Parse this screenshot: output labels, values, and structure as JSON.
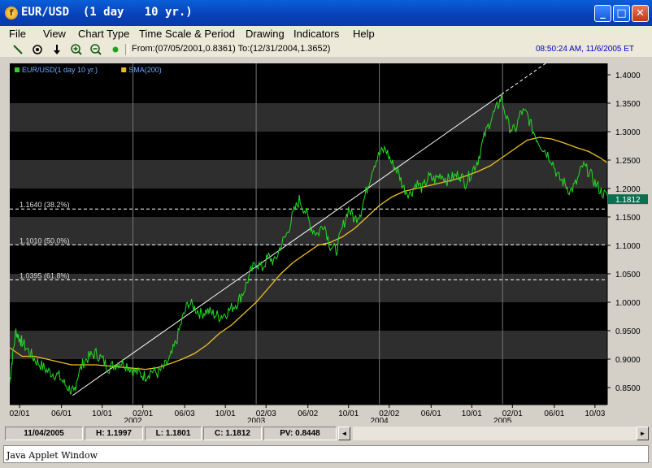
{
  "window": {
    "title": "EUR/USD  (1 day   10 yr.)",
    "app_icon": "f",
    "buttons": {
      "minimize": "_",
      "maximize": "□",
      "close": "✕"
    }
  },
  "menu": [
    "File",
    "View",
    "Chart Type",
    "Time Scale & Period",
    "Drawing",
    "Indicators",
    "Help"
  ],
  "toolbar": {
    "icons": [
      "line-tool-icon",
      "target-icon",
      "down-arrow-icon",
      "zoom-in-icon",
      "zoom-out-icon",
      "green-dot-icon"
    ],
    "range": "From:(07/05/2001,0.8361) To:(12/31/2004,1.3652)",
    "datetime": "08:50:24 AM, 11/6/2005 ET"
  },
  "legend": [
    {
      "label": "EUR/USD(1 day  10 yr.)",
      "color": "#33cc33"
    },
    {
      "label": "SMA(200)",
      "color": "#e8b820"
    }
  ],
  "colors": {
    "price": "#22dd22",
    "sma": "#f0c020",
    "background": "#000000",
    "band": "#2e2e2e",
    "last_price_bg": "#0a7050"
  },
  "fib_levels": [
    {
      "label": "1.1640 (38.2%)",
      "value": 1.164
    },
    {
      "label": "1.1010 (50.0%)",
      "value": 1.101
    },
    {
      "label": "1.0395 (61.8%)",
      "value": 1.0395
    }
  ],
  "trendline": {
    "start": [
      2001.51,
      0.8361
    ],
    "end": [
      2004.99,
      1.3652
    ],
    "extend_to": 2005.4
  },
  "chart_data": {
    "type": "line",
    "ylim": [
      0.82,
      1.42
    ],
    "xlim": [
      2001.0,
      2005.85
    ],
    "y_ticks": [
      0.85,
      0.9,
      0.95,
      1.0,
      1.05,
      1.1,
      1.15,
      1.2,
      1.25,
      1.3,
      1.35,
      1.4
    ],
    "y_tick_labels": [
      "0.8500",
      "0.9000",
      "0.9500",
      "1.0000",
      "1.0500",
      "1.1000",
      "1.1500",
      "1.2000",
      "1.2500",
      "1.3000",
      "1.3500",
      "1.4000"
    ],
    "x_ticks": [
      {
        "label": "02/01",
        "x": 2001.08
      },
      {
        "label": "06/01",
        "x": 2001.42
      },
      {
        "label": "10/01",
        "x": 2001.75
      },
      {
        "label": "02/01",
        "x": 2002.08
      },
      {
        "label": "06/03",
        "x": 2002.42
      },
      {
        "label": "10/01",
        "x": 2002.75
      },
      {
        "label": "02/03",
        "x": 2003.08
      },
      {
        "label": "06/02",
        "x": 2003.42
      },
      {
        "label": "10/01",
        "x": 2003.75
      },
      {
        "label": "02/02",
        "x": 2004.08
      },
      {
        "label": "06/01",
        "x": 2004.42
      },
      {
        "label": "10/01",
        "x": 2004.75
      },
      {
        "label": "02/01",
        "x": 2005.08
      },
      {
        "label": "06/01",
        "x": 2005.42
      },
      {
        "label": "10/03",
        "x": 2005.75
      }
    ],
    "year_ticks": [
      {
        "label": "2002",
        "x": 2002.0
      },
      {
        "label": "2003",
        "x": 2003.0
      },
      {
        "label": "2004",
        "x": 2004.0
      },
      {
        "label": "2005",
        "x": 2005.0
      }
    ],
    "last_price": "1.1812",
    "series": [
      {
        "name": "EUR/USD(1 day  10 yr.)",
        "x": [
          2001.0,
          2001.02,
          2001.05,
          2001.08,
          2001.1,
          2001.15,
          2001.2,
          2001.25,
          2001.3,
          2001.35,
          2001.4,
          2001.45,
          2001.5,
          2001.52,
          2001.55,
          2001.6,
          2001.65,
          2001.7,
          2001.75,
          2001.8,
          2001.85,
          2001.9,
          2001.95,
          2002.0,
          2002.05,
          2002.1,
          2002.15,
          2002.2,
          2002.25,
          2002.3,
          2002.35,
          2002.4,
          2002.45,
          2002.5,
          2002.55,
          2002.6,
          2002.65,
          2002.7,
          2002.75,
          2002.8,
          2002.85,
          2002.9,
          2002.95,
          2003.0,
          2003.05,
          2003.1,
          2003.15,
          2003.2,
          2003.25,
          2003.3,
          2003.35,
          2003.4,
          2003.45,
          2003.5,
          2003.55,
          2003.6,
          2003.65,
          2003.7,
          2003.75,
          2003.8,
          2003.85,
          2003.9,
          2003.95,
          2004.0,
          2004.05,
          2004.1,
          2004.15,
          2004.2,
          2004.25,
          2004.3,
          2004.35,
          2004.4,
          2004.45,
          2004.5,
          2004.55,
          2004.6,
          2004.65,
          2004.7,
          2004.75,
          2004.8,
          2004.85,
          2004.9,
          2004.95,
          2004.99,
          2005.05,
          2005.1,
          2005.15,
          2005.2,
          2005.25,
          2005.3,
          2005.35,
          2005.4,
          2005.45,
          2005.5,
          2005.55,
          2005.6,
          2005.65,
          2005.7,
          2005.75,
          2005.8,
          2005.85
        ],
        "values": [
          0.86,
          0.9,
          0.95,
          0.935,
          0.93,
          0.915,
          0.9,
          0.89,
          0.88,
          0.875,
          0.87,
          0.855,
          0.845,
          0.84,
          0.87,
          0.895,
          0.905,
          0.91,
          0.9,
          0.885,
          0.89,
          0.895,
          0.89,
          0.88,
          0.875,
          0.87,
          0.88,
          0.875,
          0.885,
          0.9,
          0.93,
          0.97,
          1.0,
          0.99,
          0.98,
          0.985,
          0.98,
          0.975,
          0.98,
          0.99,
          1.0,
          1.02,
          1.05,
          1.07,
          1.06,
          1.08,
          1.07,
          1.1,
          1.12,
          1.155,
          1.18,
          1.16,
          1.13,
          1.12,
          1.14,
          1.1,
          1.09,
          1.13,
          1.165,
          1.145,
          1.16,
          1.2,
          1.24,
          1.26,
          1.27,
          1.245,
          1.23,
          1.2,
          1.19,
          1.21,
          1.2,
          1.22,
          1.215,
          1.225,
          1.215,
          1.22,
          1.225,
          1.21,
          1.23,
          1.25,
          1.29,
          1.32,
          1.34,
          1.36,
          1.31,
          1.3,
          1.335,
          1.33,
          1.3,
          1.28,
          1.265,
          1.25,
          1.22,
          1.21,
          1.195,
          1.21,
          1.24,
          1.23,
          1.21,
          1.195,
          1.185
        ]
      },
      {
        "name": "SMA(200)",
        "x": [
          2001.0,
          2001.1,
          2001.2,
          2001.3,
          2001.4,
          2001.5,
          2001.6,
          2001.7,
          2001.8,
          2001.9,
          2002.0,
          2002.1,
          2002.2,
          2002.3,
          2002.4,
          2002.5,
          2002.6,
          2002.7,
          2002.8,
          2002.9,
          2003.0,
          2003.1,
          2003.2,
          2003.3,
          2003.4,
          2003.5,
          2003.6,
          2003.7,
          2003.8,
          2003.9,
          2004.0,
          2004.1,
          2004.2,
          2004.3,
          2004.4,
          2004.5,
          2004.6,
          2004.7,
          2004.8,
          2004.9,
          2005.0,
          2005.1,
          2005.2,
          2005.3,
          2005.4,
          2005.5,
          2005.6,
          2005.7,
          2005.8,
          2005.85
        ],
        "values": [
          0.92,
          0.905,
          0.905,
          0.9,
          0.895,
          0.89,
          0.89,
          0.89,
          0.888,
          0.886,
          0.884,
          0.882,
          0.885,
          0.892,
          0.9,
          0.91,
          0.925,
          0.945,
          0.96,
          0.98,
          1.0,
          1.025,
          1.05,
          1.07,
          1.085,
          1.1,
          1.105,
          1.115,
          1.13,
          1.15,
          1.17,
          1.185,
          1.195,
          1.2,
          1.205,
          1.21,
          1.215,
          1.222,
          1.23,
          1.24,
          1.255,
          1.27,
          1.285,
          1.29,
          1.287,
          1.28,
          1.272,
          1.265,
          1.253,
          1.245
        ]
      }
    ]
  },
  "status": {
    "date": "11/04/2005",
    "high": "H: 1.1997",
    "low": "L: 1.1801",
    "close": "C: 1.1812",
    "pv": "PV: 0.8448",
    "scroll_left": "◄",
    "scroll_right": "►"
  },
  "applet_label": "Java Applet Window"
}
